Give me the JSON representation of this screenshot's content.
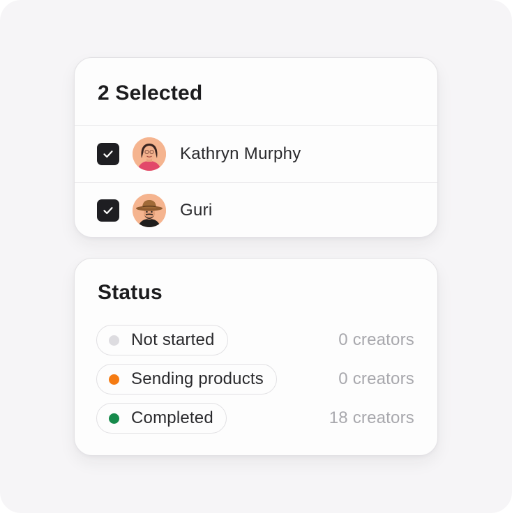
{
  "selection": {
    "title": "2 Selected",
    "items": [
      {
        "name": "Kathryn Murphy",
        "checked": true
      },
      {
        "name": "Guri",
        "checked": true
      }
    ]
  },
  "status": {
    "title": "Status",
    "rows": [
      {
        "label": "Not started",
        "count": "0 creators",
        "color": "#dddce0"
      },
      {
        "label": "Sending products",
        "count": "0 creators",
        "color": "#f57b12"
      },
      {
        "label": "Completed",
        "count": "18 creators",
        "color": "#168a4b"
      }
    ]
  }
}
